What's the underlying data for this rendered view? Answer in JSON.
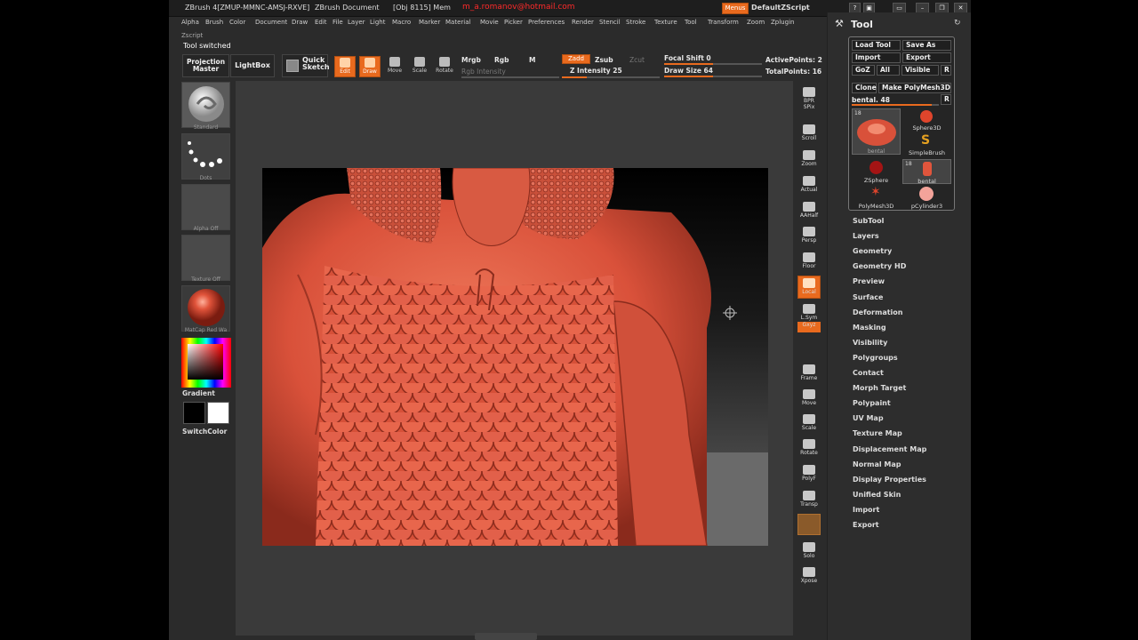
{
  "titlebar": {
    "app_title": "ZBrush 4[ZMUP-MMNC-AMSJ-RXVE]",
    "document": "ZBrush Document",
    "obj_mem": "[Obj 8115] Mem",
    "watermark": "m_a.romanov@hotmail.com",
    "menus_label": "Menus",
    "script_label": "DefaultZScript"
  },
  "menubar": [
    "Alpha",
    "Brush",
    "Color",
    "Document",
    "Draw",
    "Edit",
    "File",
    "Layer",
    "Light",
    "Macro",
    "Marker",
    "Material",
    "Movie",
    "Picker",
    "Preferences",
    "Render",
    "Stencil",
    "Stroke",
    "Texture",
    "Tool",
    "Transform",
    "Zoom",
    "Zplugin"
  ],
  "zscript_label": "Zscript",
  "status_text": "Tool switched",
  "shelf": {
    "projection_master": "Projection Master",
    "lightbox": "LightBox",
    "quick_sketch": "Quick Sketch",
    "edit": "Edit",
    "draw": "Draw",
    "move": "Move",
    "scale": "Scale",
    "rotate": "Rotate",
    "mrgb": "Mrgb",
    "rgb": "Rgb",
    "m": "M",
    "rgb_intensity": "Rgb Intensity",
    "zadd": "Zadd",
    "zsub": "Zsub",
    "zcut": "Zcut",
    "z_intensity": "Z Intensity 25",
    "z_intensity_value": 0.25,
    "focal_shift": "Focal Shift 0",
    "focal_shift_value": 0.5,
    "draw_size": "Draw Size 64",
    "draw_size_value": 0.5,
    "active_points": "ActivePoints: 2",
    "total_points": "TotalPoints: 16"
  },
  "left": {
    "brush": "Standard",
    "stroke": "Dots",
    "alpha": "Alpha Off",
    "texture": "Texture Off",
    "material": "MatCap Red Wa",
    "gradient": "Gradient",
    "switch_color": "SwitchColor"
  },
  "rstrip": [
    "BPR",
    "SPix",
    "Scroll",
    "Zoom",
    "Actual",
    "AAHalf",
    "Persp",
    "Floor",
    "Local",
    "L.Sym",
    "Gxyz",
    "Frame",
    "Move",
    "Scale",
    "Rotate",
    "PolyF",
    "Transp",
    "Solo",
    "Xpose"
  ],
  "tool": {
    "title": "Tool",
    "load_tool": "Load Tool",
    "save_as": "Save As",
    "import": "Import",
    "export": "Export",
    "goz": "GoZ",
    "all": "All",
    "visible": "Visible",
    "r": "R",
    "clone": "Clone",
    "make_polymesh": "Make PolyMesh3D",
    "current_tool": "bental. 48",
    "thumbs": [
      {
        "name": "bental",
        "count": "18"
      },
      {
        "name": "Sphere3D"
      },
      {
        "name": "SimpleBrush"
      },
      {
        "name": "ZSphere"
      },
      {
        "name": "bental",
        "count": "18"
      },
      {
        "name": "PolyMesh3D"
      },
      {
        "name": "pCylinder3"
      }
    ],
    "subpalettes": [
      "SubTool",
      "Layers",
      "Geometry",
      "Geometry HD",
      "Preview",
      "Surface",
      "Deformation",
      "Masking",
      "Visibility",
      "Polygroups",
      "Contact",
      "Morph Target",
      "Polypaint",
      "UV Map",
      "Texture Map",
      "Displacement Map",
      "Normal Map",
      "Display Properties",
      "Unified Skin",
      "Import",
      "Export"
    ]
  },
  "colors": {
    "accent": "#e96a1e",
    "clay": "#d9513a",
    "canvas_bg": "#3a3a3a",
    "watermark": "#ff2a2a"
  }
}
